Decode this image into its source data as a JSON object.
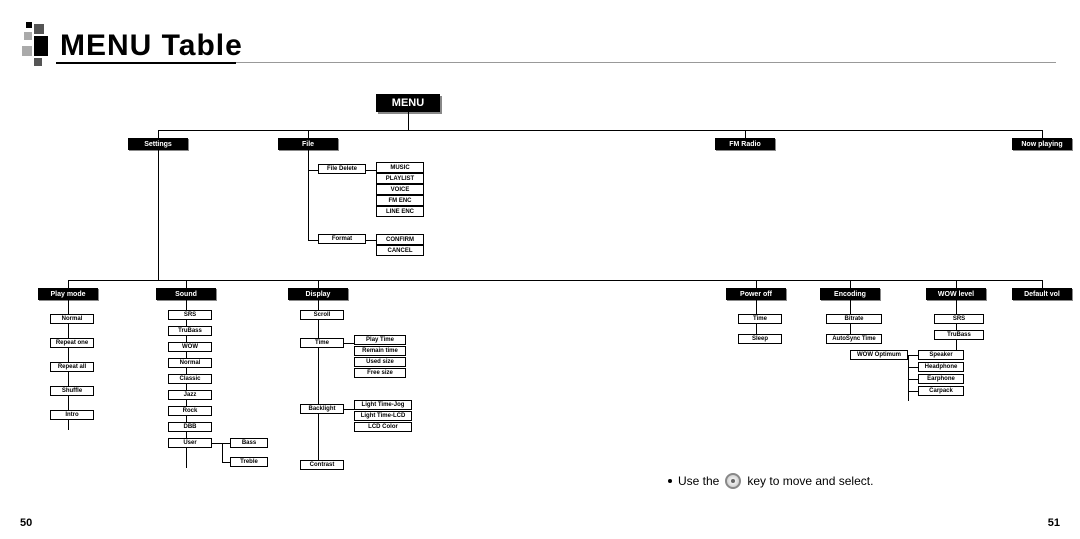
{
  "title": "MENU Table",
  "root": "MENU",
  "level1": {
    "settings": "Settings",
    "file": "File",
    "fmradio": "FM Radio",
    "nowplaying": "Now playing"
  },
  "file": {
    "file_delete": "File Delete",
    "format": "Format",
    "delete_opts": [
      "MUSIC",
      "PLAYLIST",
      "VOICE",
      "FM ENC",
      "LINE ENC"
    ],
    "format_opts": [
      "CONFIRM",
      "CANCEL"
    ]
  },
  "settings": {
    "playmode": "Play mode",
    "sound": "Sound",
    "display": "Display",
    "poweroff": "Power off",
    "encoding": "Encoding",
    "wowlevel": "WOW level",
    "defaultvol": "Default vol"
  },
  "playmode_items": [
    "Normal",
    "Repeat one",
    "Repeat all",
    "Shuffle",
    "Intro"
  ],
  "sound_items": [
    "SRS",
    "TruBass",
    "WOW",
    "Normal",
    "Classic",
    "Jazz",
    "Rock",
    "DBB",
    "User"
  ],
  "sound_user": [
    "Bass",
    "Treble"
  ],
  "display_items": {
    "scroll": "Scroll",
    "time": "Time",
    "backlight": "Backlight",
    "contrast": "Contrast"
  },
  "display_time": [
    "Play Time",
    "Remain time",
    "Used size",
    "Free size"
  ],
  "display_backlight": [
    "Light Time-Jog",
    "Light Time-LCD",
    "LCD Color"
  ],
  "poweroff_items": [
    "Time",
    "Sleep"
  ],
  "encoding_items": [
    "Bitrate",
    "AutoSync Time"
  ],
  "wow_items": [
    "SRS",
    "TruBass",
    "WOW Optimum"
  ],
  "wow_optimum": [
    "Speaker",
    "Headphone",
    "Earphone",
    "Carpack"
  ],
  "note_pre": "Use the",
  "note_post": "key to move and select.",
  "page_left": "50",
  "page_right": "51"
}
